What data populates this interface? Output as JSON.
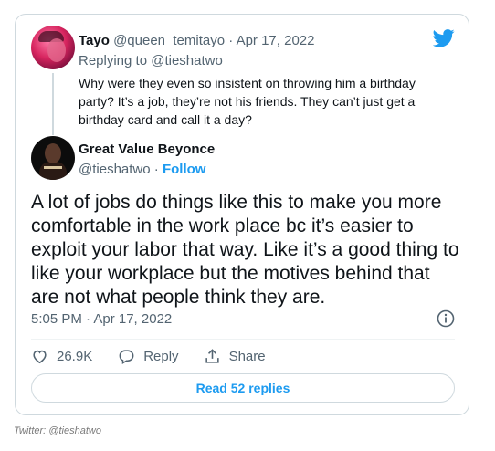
{
  "parent_tweet": {
    "name": "Tayo",
    "handle": "@queen_temitayo",
    "separator": "·",
    "date": "Apr 17, 2022",
    "replying_prefix": "Replying to",
    "replying_handle": "@tieshatwo",
    "text": "Why were they even so insistent on throwing him a birthday party? It’s a job, they’re not his friends. They can’t just get a birthday card and call it a day?"
  },
  "main_tweet": {
    "name": "Great Value Beyonce",
    "handle": "@tieshatwo",
    "separator": "·",
    "follow_label": "Follow",
    "text": "A lot of jobs do things like this to make you more comfortable in the work place bc it’s easier to exploit your labor that way. Like it’s a good thing to like your workplace but the motives behind that are not what people think they are.",
    "timestamp": "5:05 PM · Apr 17, 2022"
  },
  "actions": {
    "like_count": "26.9K",
    "reply_label": "Reply",
    "share_label": "Share",
    "read_replies_label": "Read 52 replies"
  },
  "credit": "Twitter: @tieshatwo",
  "colors": {
    "accent": "#1d9bf0",
    "text": "#0f1419",
    "muted": "#536471",
    "border": "#cfd9de"
  },
  "icons": {
    "brand": "twitter-bird-icon",
    "info": "info-icon",
    "like": "heart-icon",
    "reply": "speech-bubble-icon",
    "share": "share-upload-icon"
  }
}
